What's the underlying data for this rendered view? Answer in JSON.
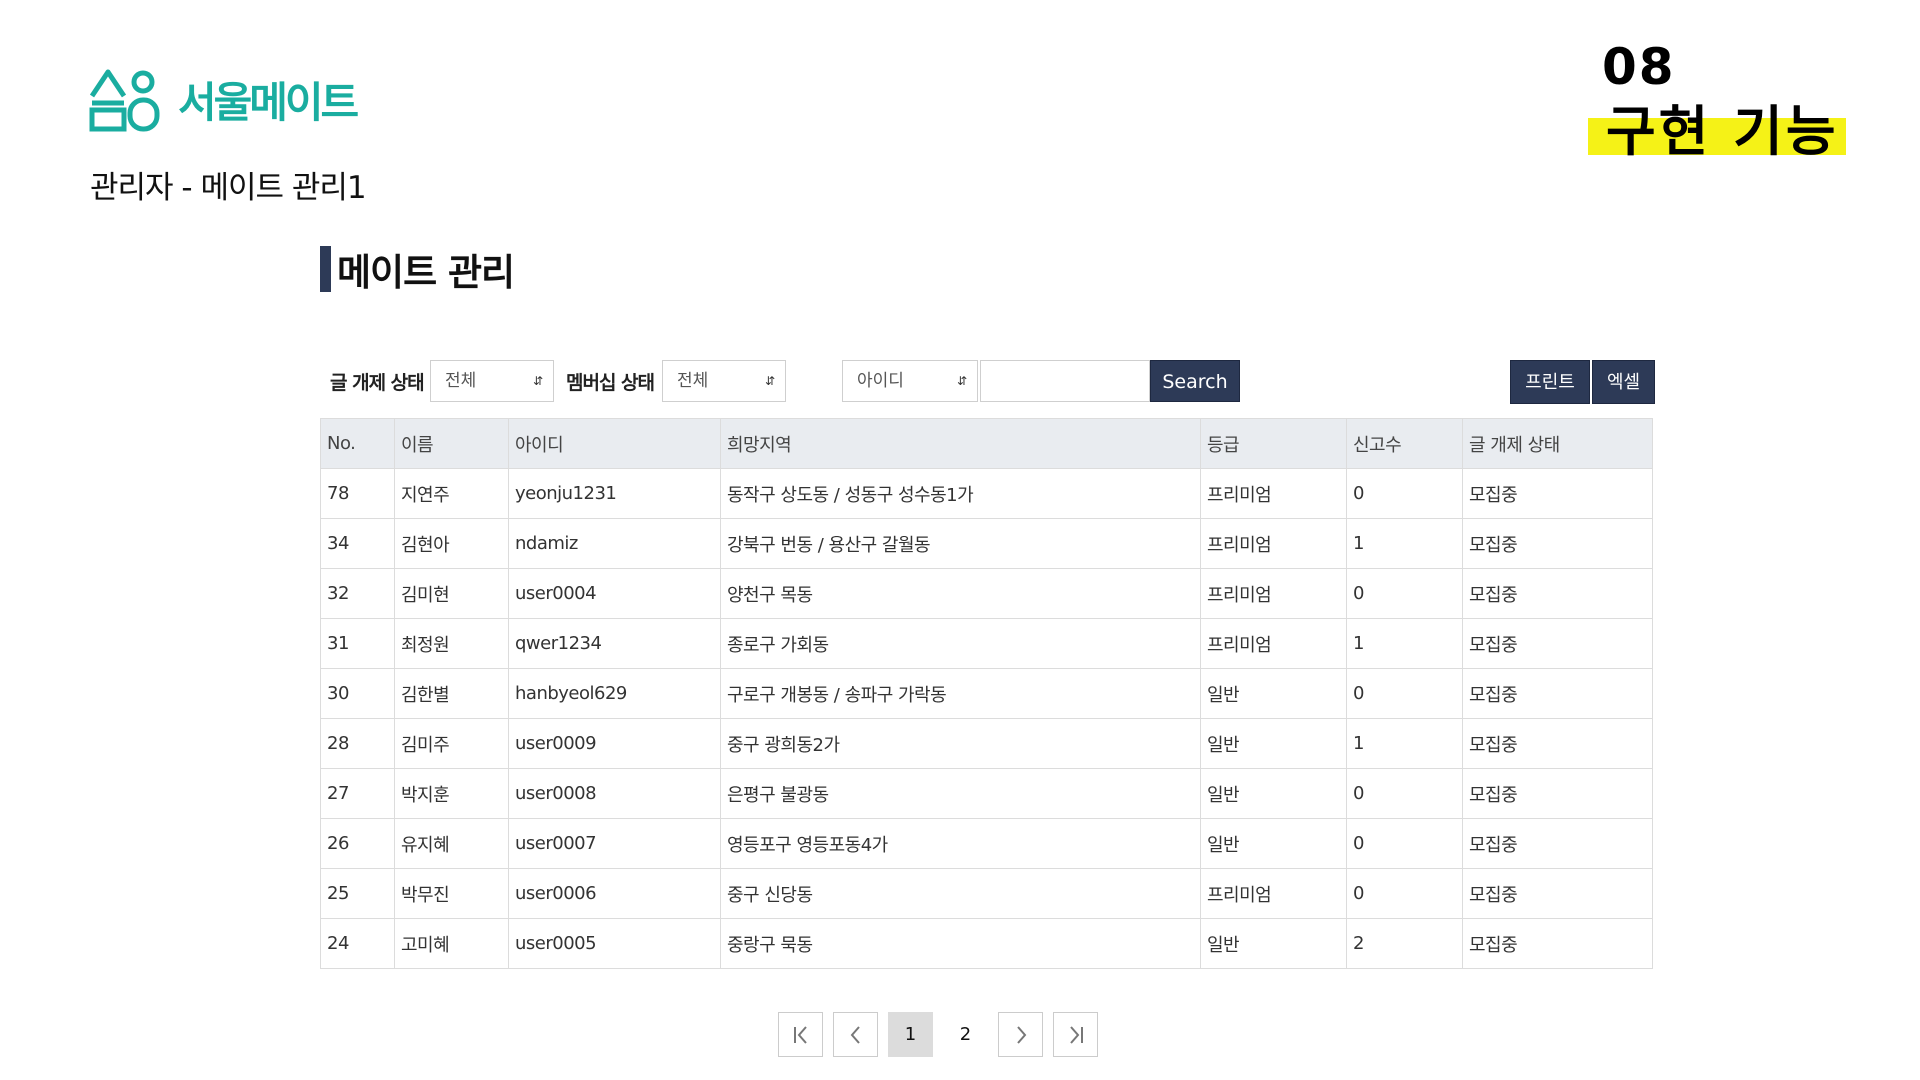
{
  "brand": {
    "name": "서울메이트",
    "color": "#1aada0",
    "logo_icon": "house-person-icon"
  },
  "page_subtitle": "관리자 - 메이트 관리1",
  "slide": {
    "number": "08",
    "title": "구현 기능",
    "highlight_color": "#f5f217"
  },
  "section_title": "메이트 관리",
  "filters": {
    "post_status_label": "글 개제 상태",
    "post_status_value": "전체",
    "membership_status_label": "멤버십 상태",
    "membership_status_value": "전체",
    "search_field_value": "아이디",
    "search_input_value": "",
    "search_label": "Search"
  },
  "actions": {
    "print_label": "프린트",
    "excel_label": "엑셀"
  },
  "table": {
    "headers": [
      "No.",
      "이름",
      "아이디",
      "희망지역",
      "등급",
      "신고수",
      "글 개제 상태"
    ],
    "rows": [
      [
        "78",
        "지연주",
        "yeonju1231",
        "동작구 상도동 / 성동구 성수동1가",
        "프리미엄",
        "0",
        "모집중"
      ],
      [
        "34",
        "김현아",
        "ndamiz",
        "강북구 번동 / 용산구 갈월동",
        "프리미엄",
        "1",
        "모집중"
      ],
      [
        "32",
        "김미현",
        "user0004",
        "양천구 목동",
        "프리미엄",
        "0",
        "모집중"
      ],
      [
        "31",
        "최정원",
        "qwer1234",
        "종로구 가회동",
        "프리미엄",
        "1",
        "모집중"
      ],
      [
        "30",
        "김한별",
        "hanbyeol629",
        "구로구 개봉동 / 송파구 가락동",
        "일반",
        "0",
        "모집중"
      ],
      [
        "28",
        "김미주",
        "user0009",
        "중구 광희동2가",
        "일반",
        "1",
        "모집중"
      ],
      [
        "27",
        "박지훈",
        "user0008",
        "은평구 불광동",
        "일반",
        "0",
        "모집중"
      ],
      [
        "26",
        "유지혜",
        "user0007",
        "영등포구 영등포동4가",
        "일반",
        "0",
        "모집중"
      ],
      [
        "25",
        "박무진",
        "user0006",
        "중구 신당동",
        "프리미엄",
        "0",
        "모집중"
      ],
      [
        "24",
        "고미혜",
        "user0005",
        "중랑구 묵동",
        "일반",
        "2",
        "모집중"
      ]
    ]
  },
  "pagination": {
    "first_icon": "first-page-icon",
    "prev_icon": "chevron-left-icon",
    "next_icon": "chevron-right-icon",
    "last_icon": "last-page-icon",
    "pages": [
      "1",
      "2"
    ],
    "current": "1"
  },
  "colors": {
    "navy": "#2d3a57",
    "header_bg": "#e9ecf0"
  }
}
